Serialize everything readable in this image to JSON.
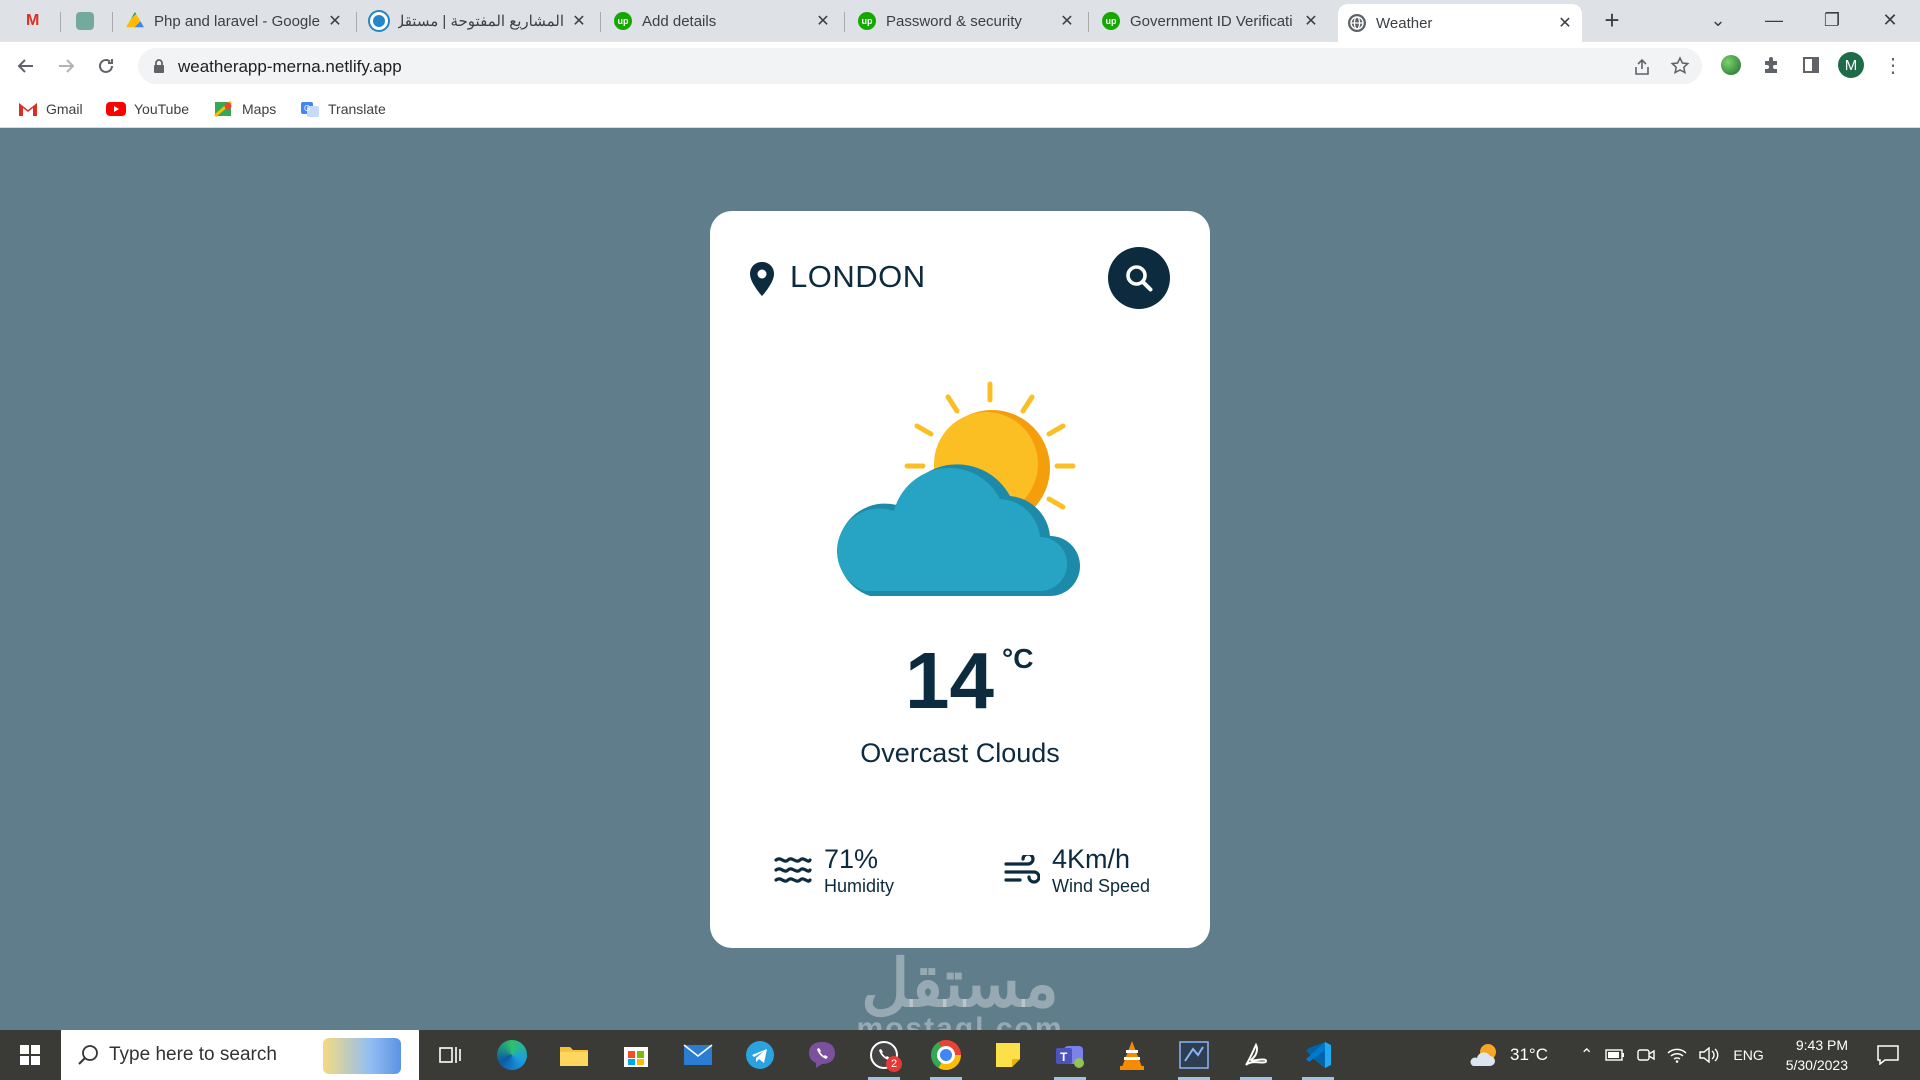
{
  "tabs": [
    {
      "title": "",
      "icon": "gmail-icon",
      "closable": false
    },
    {
      "title": "",
      "icon": "chatgpt-icon",
      "closable": false
    },
    {
      "title": "Php and laravel - Google",
      "icon": "google-drive-icon",
      "closable": true
    },
    {
      "title": "المشاريع المفتوحة | مستقل",
      "icon": "mostaql-icon",
      "closable": true
    },
    {
      "title": "Add details",
      "icon": "upwork-icon",
      "closable": true
    },
    {
      "title": "Password & security",
      "icon": "upwork-icon",
      "closable": true
    },
    {
      "title": "Government ID Verificati",
      "icon": "upwork-icon",
      "closable": true
    },
    {
      "title": "Weather",
      "icon": "globe-icon",
      "closable": true,
      "active": true
    }
  ],
  "toolbar": {
    "url": "weatherapp-merna.netlify.app",
    "profile_initial": "M"
  },
  "bookmarks": [
    {
      "label": "Gmail",
      "icon": "gmail-icon"
    },
    {
      "label": "YouTube",
      "icon": "youtube-icon"
    },
    {
      "label": "Maps",
      "icon": "maps-icon"
    },
    {
      "label": "Translate",
      "icon": "translate-icon"
    }
  ],
  "weather": {
    "city": "LONDON",
    "temperature": "14",
    "unit": "°C",
    "description": "Overcast Clouds",
    "humidity_value": "71%",
    "humidity_label": "Humidity",
    "wind_value": "4Km/h",
    "wind_label": "Wind Speed"
  },
  "watermark": {
    "arabic": "مستقل",
    "latin": "mostaql.com"
  },
  "taskbar": {
    "search_placeholder": "Type here to search",
    "weather_temp": "31°C",
    "language": "ENG",
    "time": "9:43 PM",
    "date": "5/30/2023",
    "notification_badge": "2"
  },
  "colors": {
    "page_bg": "#607d8b",
    "card_bg": "#ffffff",
    "primary_text": "#0d2b3e",
    "sun": "#fbbf24",
    "sun_shadow": "#f59e0b",
    "cloud": "#27a4c4",
    "cloud_shadow": "#1c8aa8"
  }
}
